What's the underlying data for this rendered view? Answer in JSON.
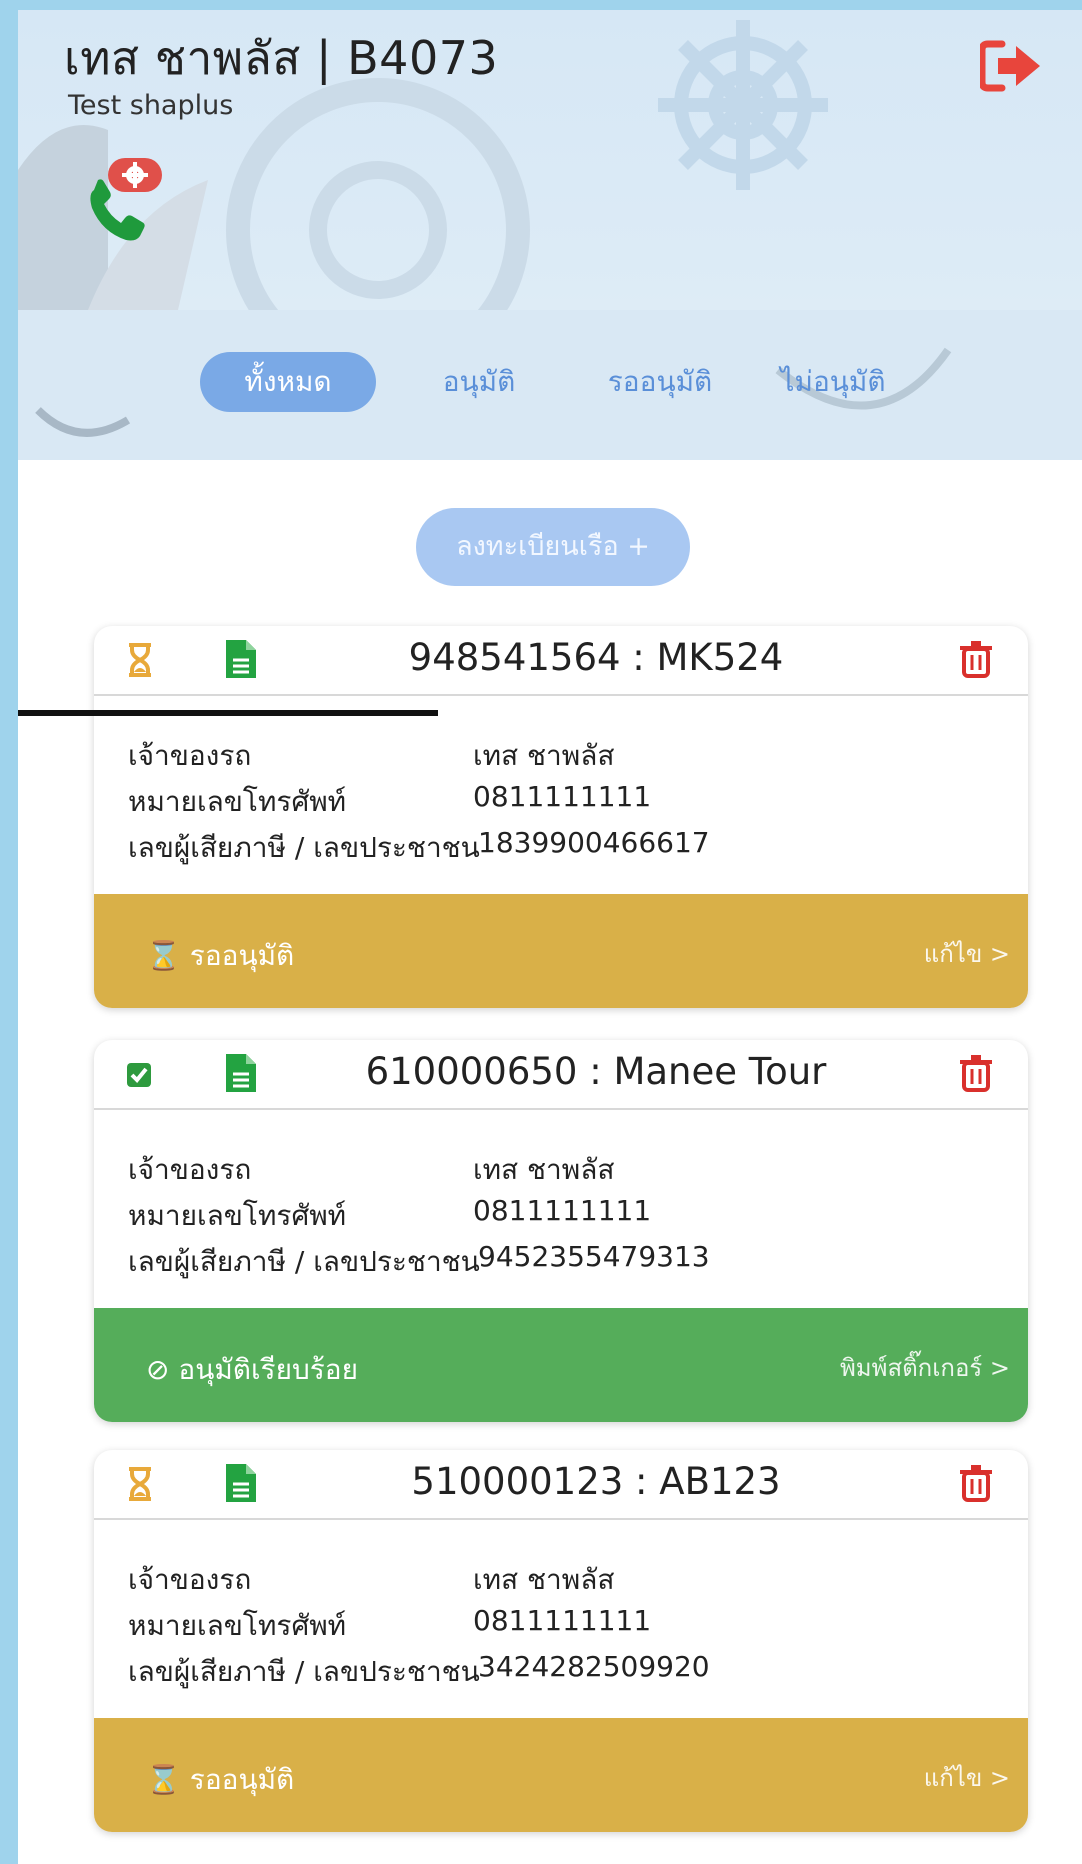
{
  "header": {
    "title": "เทส ชาพลัส | B4073",
    "subtitle": "Test shaplus"
  },
  "tabs": [
    {
      "label": "ทั้งหมด",
      "active": true
    },
    {
      "label": "อนุมัติ",
      "active": false
    },
    {
      "label": "รออนุมัติ",
      "active": false
    },
    {
      "label": "ไม่อนุมัติ",
      "active": false
    }
  ],
  "add_button": {
    "label": "ลงทะเบียนเรือ +"
  },
  "labels": {
    "owner": "เจ้าของรถ",
    "phone": "หมายเลขโทรศัพท์",
    "tax_id": "เลขผู้เสียภาษี / เลขประชาชน"
  },
  "colors": {
    "pending": "#d9b048",
    "approved": "#55ad5a",
    "danger": "#d9302c",
    "doc": "#23a341",
    "accent": "#7aa9e6"
  },
  "cards": [
    {
      "id_text": "948541564 : MK524",
      "status_icon": "hourglass-icon",
      "owner": "เทส ชาพลัส",
      "phone": "0811111111",
      "tax_id": "1839900466617",
      "status": "pending",
      "status_label": "รออนุมัติ",
      "action_label": "แก้ไข >"
    },
    {
      "id_text": "610000650 : Manee Tour",
      "status_icon": "checkbox-checked-icon",
      "owner": "เทส ชาพลัส",
      "phone": "0811111111",
      "tax_id": "9452355479313",
      "status": "approved",
      "status_label": "อนุมัติเรียบร้อย",
      "action_label": "พิมพ์สติ๊กเกอร์ >"
    },
    {
      "id_text": "510000123 : AB123",
      "status_icon": "hourglass-icon",
      "owner": "เทส ชาพลัส",
      "phone": "0811111111",
      "tax_id": "3424282509920",
      "status": "pending",
      "status_label": "รออนุมัติ",
      "action_label": "แก้ไข >"
    }
  ]
}
